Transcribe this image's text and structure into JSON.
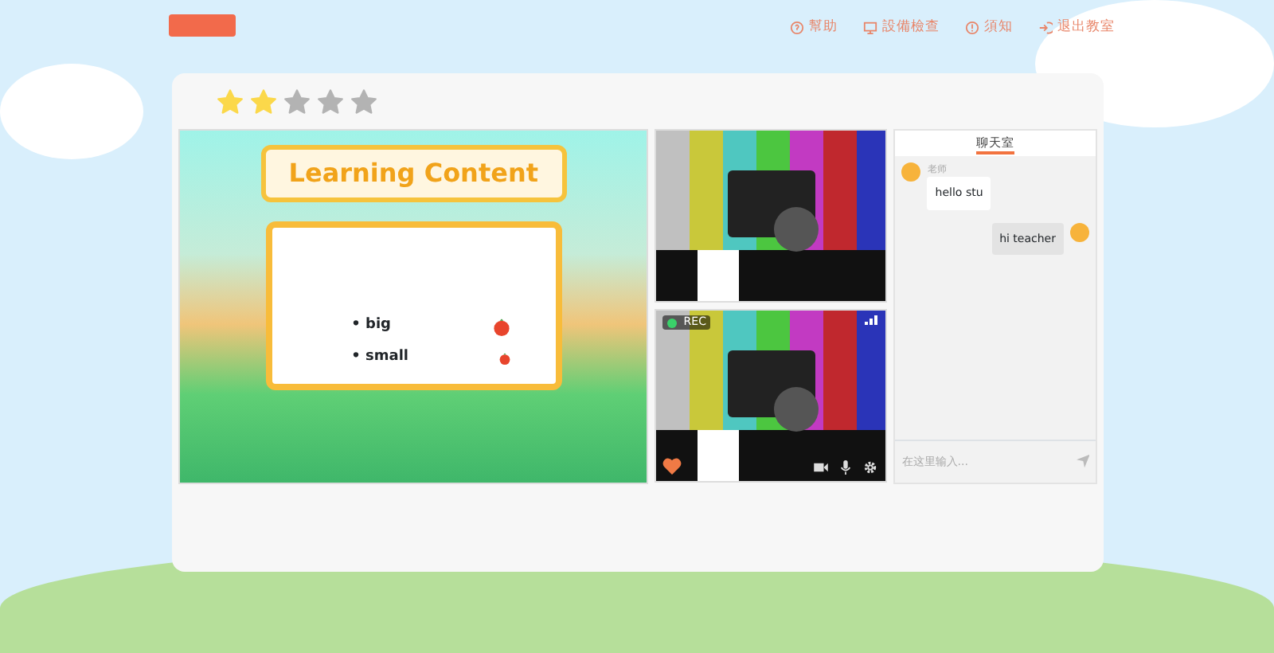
{
  "top_nav": [
    {
      "kind": "help",
      "label": "幫助"
    },
    {
      "kind": "device",
      "label": "設備檢查"
    },
    {
      "kind": "notice",
      "label": "須知"
    },
    {
      "kind": "exit",
      "label": "退出教室"
    }
  ],
  "rating": {
    "stars": 2
  },
  "lesson": {
    "title": "Learning Content",
    "words": [
      {
        "text": "• big",
        "kind": "big"
      },
      {
        "text": "• small",
        "kind": "small"
      }
    ]
  },
  "videos": [
    {
      "rec": false
    },
    {
      "rec": true,
      "rec_label": "REC"
    }
  ],
  "chat": {
    "title": "聊天室",
    "messages": [
      {
        "kind": "incoming",
        "sender": "老师",
        "text": "hello stu"
      },
      {
        "kind": "outgoing",
        "text": "hi teacher"
      }
    ],
    "input": {
      "placeholder": "在这里输入..."
    }
  }
}
